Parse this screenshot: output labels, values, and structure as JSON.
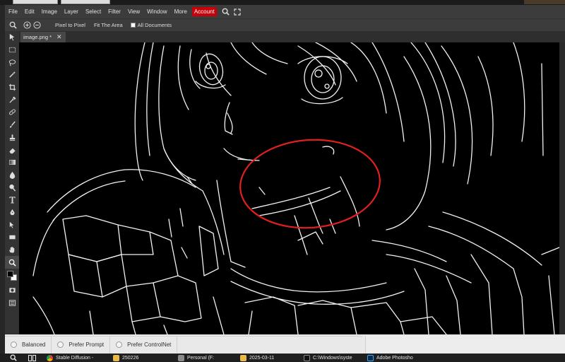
{
  "menubar": {
    "items": [
      "File",
      "Edit",
      "Image",
      "Layer",
      "Select",
      "Filter",
      "View",
      "Window",
      "More"
    ],
    "account_label": "Account",
    "account_color": "#c8000a"
  },
  "options": {
    "pixel_to_pixel": "Pixel to Pixel",
    "fit_area": "Fit The Area",
    "all_documents": "All Documents"
  },
  "document": {
    "tab_name": "image.png *",
    "close_glyph": "✕"
  },
  "toolbar": {
    "icons": [
      "move-icon",
      "marquee-icon",
      "lasso-icon",
      "magic-wand-icon",
      "crop-icon",
      "eyedropper-icon",
      "healing-icon",
      "brush-icon",
      "stamp-icon",
      "eraser-icon",
      "gradient-icon",
      "blur-icon",
      "dodge-icon",
      "type-icon",
      "pen-icon",
      "path-select-icon",
      "shape-icon",
      "hand-icon",
      "zoom-icon"
    ],
    "active": "zoom-icon",
    "foreground_color": "#000000",
    "background_color": "#ffffff"
  },
  "canvas": {
    "annotation_color": "#e0201e"
  },
  "prompt_options": {
    "balanced": "Balanced",
    "prefer_prompt": "Prefer Prompt",
    "prefer_controlnet": "Prefer ControlNet"
  },
  "taskbar": {
    "items": [
      {
        "label": "Stable Diffusion -",
        "icon": "chrome-icon"
      },
      {
        "label": "250226",
        "icon": "folder-icon"
      },
      {
        "label": "Personal (F:",
        "icon": "drive-icon"
      },
      {
        "label": "2025-03-11",
        "icon": "folder-icon"
      },
      {
        "label": "C:\\Windows\\syste",
        "icon": "terminal-icon"
      },
      {
        "label": "Adobe Photosho",
        "icon": "photoshop-icon"
      }
    ]
  }
}
